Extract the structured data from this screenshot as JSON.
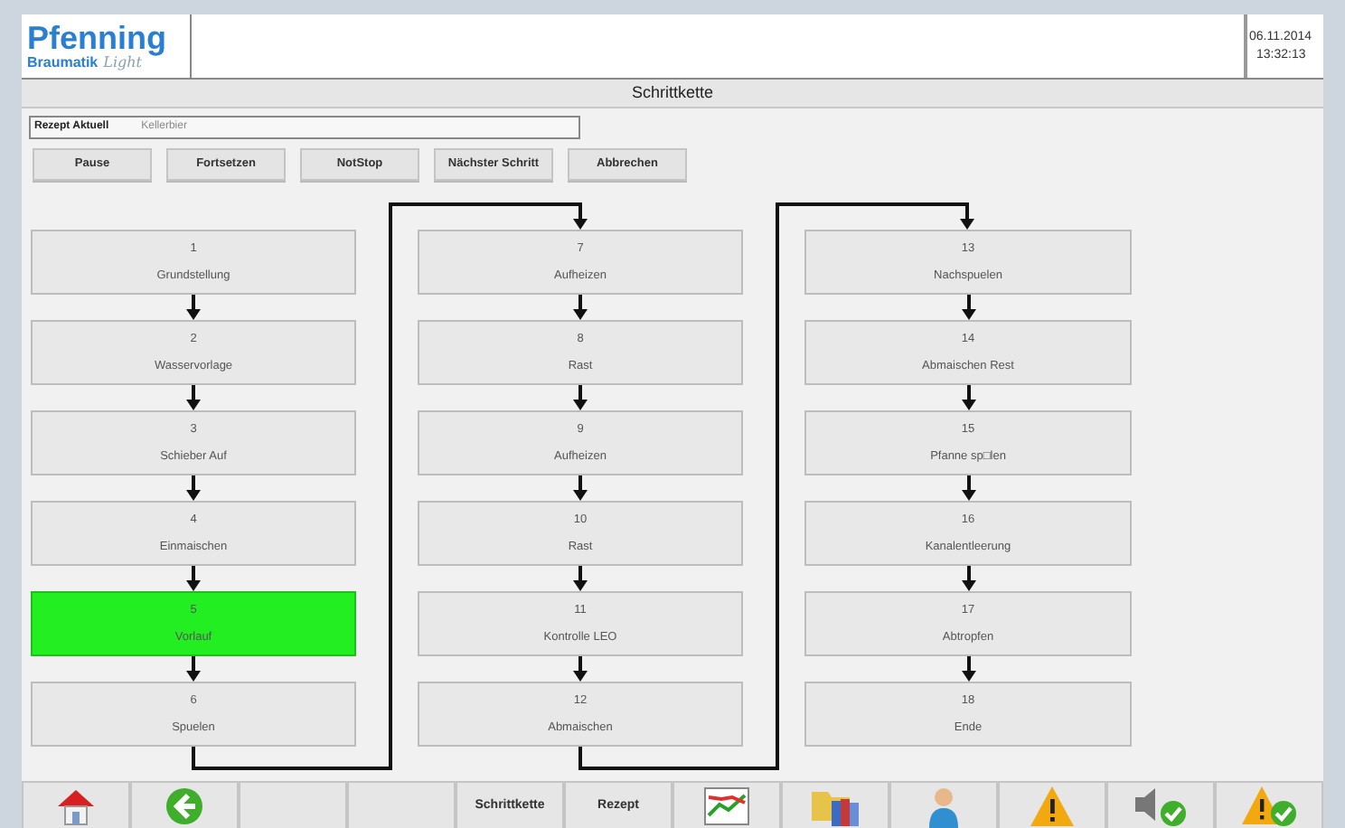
{
  "logo": {
    "name": "Pfenning",
    "sub": "Braumatik",
    "edition": "Light"
  },
  "datetime": {
    "date": "06.11.2014",
    "time": "13:32:13"
  },
  "page_title": "Schrittkette",
  "recipe": {
    "label": "Rezept Aktuell",
    "value": "Kellerbier"
  },
  "buttons": [
    "Pause",
    "Fortsetzen",
    "NotStop",
    "Nächster Schritt",
    "Abbrechen"
  ],
  "columns": [
    {
      "steps": [
        {
          "number": "1",
          "name": "Grundstellung",
          "active": false
        },
        {
          "number": "2",
          "name": "Wasservorlage",
          "active": false
        },
        {
          "number": "3",
          "name": "Schieber Auf",
          "active": false
        },
        {
          "number": "4",
          "name": "Einmaischen",
          "active": false
        },
        {
          "number": "5",
          "name": "Vorlauf",
          "active": true
        },
        {
          "number": "6",
          "name": "Spuelen",
          "active": false
        }
      ]
    },
    {
      "steps": [
        {
          "number": "7",
          "name": "Aufheizen",
          "active": false
        },
        {
          "number": "8",
          "name": "Rast",
          "active": false
        },
        {
          "number": "9",
          "name": "Aufheizen",
          "active": false
        },
        {
          "number": "10",
          "name": "Rast",
          "active": false
        },
        {
          "number": "11",
          "name": "Kontrolle LEO",
          "active": false
        },
        {
          "number": "12",
          "name": "Abmaischen",
          "active": false
        }
      ]
    },
    {
      "steps": [
        {
          "number": "13",
          "name": "Nachspuelen",
          "active": false
        },
        {
          "number": "14",
          "name": "Abmaischen Rest",
          "active": false
        },
        {
          "number": "15",
          "name": "Pfanne sp□len",
          "active": false
        },
        {
          "number": "16",
          "name": "Kanalentleerung",
          "active": false
        },
        {
          "number": "17",
          "name": "Abtropfen",
          "active": false
        },
        {
          "number": "18",
          "name": "Ende",
          "active": false
        }
      ]
    }
  ],
  "toolbar": [
    {
      "kind": "home"
    },
    {
      "kind": "back"
    },
    {
      "kind": "blank"
    },
    {
      "kind": "blank"
    },
    {
      "kind": "text",
      "label": "Schrittkette"
    },
    {
      "kind": "text",
      "label": "Rezept"
    },
    {
      "kind": "chart"
    },
    {
      "kind": "folder"
    },
    {
      "kind": "user"
    },
    {
      "kind": "warning"
    },
    {
      "kind": "speaker"
    },
    {
      "kind": "alarmok"
    }
  ]
}
